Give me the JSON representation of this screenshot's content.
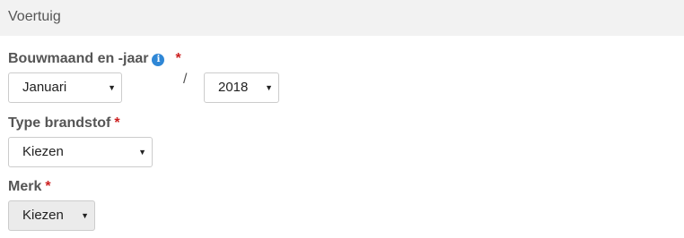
{
  "section": {
    "title": "Voertuig"
  },
  "build_date": {
    "label": "Bouwmaand en -jaar",
    "required_mark": "*",
    "info_icon": "info-icon",
    "month_value": "Januari",
    "separator": "/",
    "year_value": "2018"
  },
  "fuel_type": {
    "label": "Type brandstof",
    "required_mark": "*",
    "value": "Kiezen"
  },
  "brand": {
    "label": "Merk",
    "required_mark": "*",
    "value": "Kiezen",
    "disabled": true
  },
  "dropdown_caret": "▼",
  "colors": {
    "header_bg": "#f2f2f2",
    "required": "#cc1f1f",
    "info": "#2f87d6",
    "disabled_bg": "#ebebeb"
  }
}
